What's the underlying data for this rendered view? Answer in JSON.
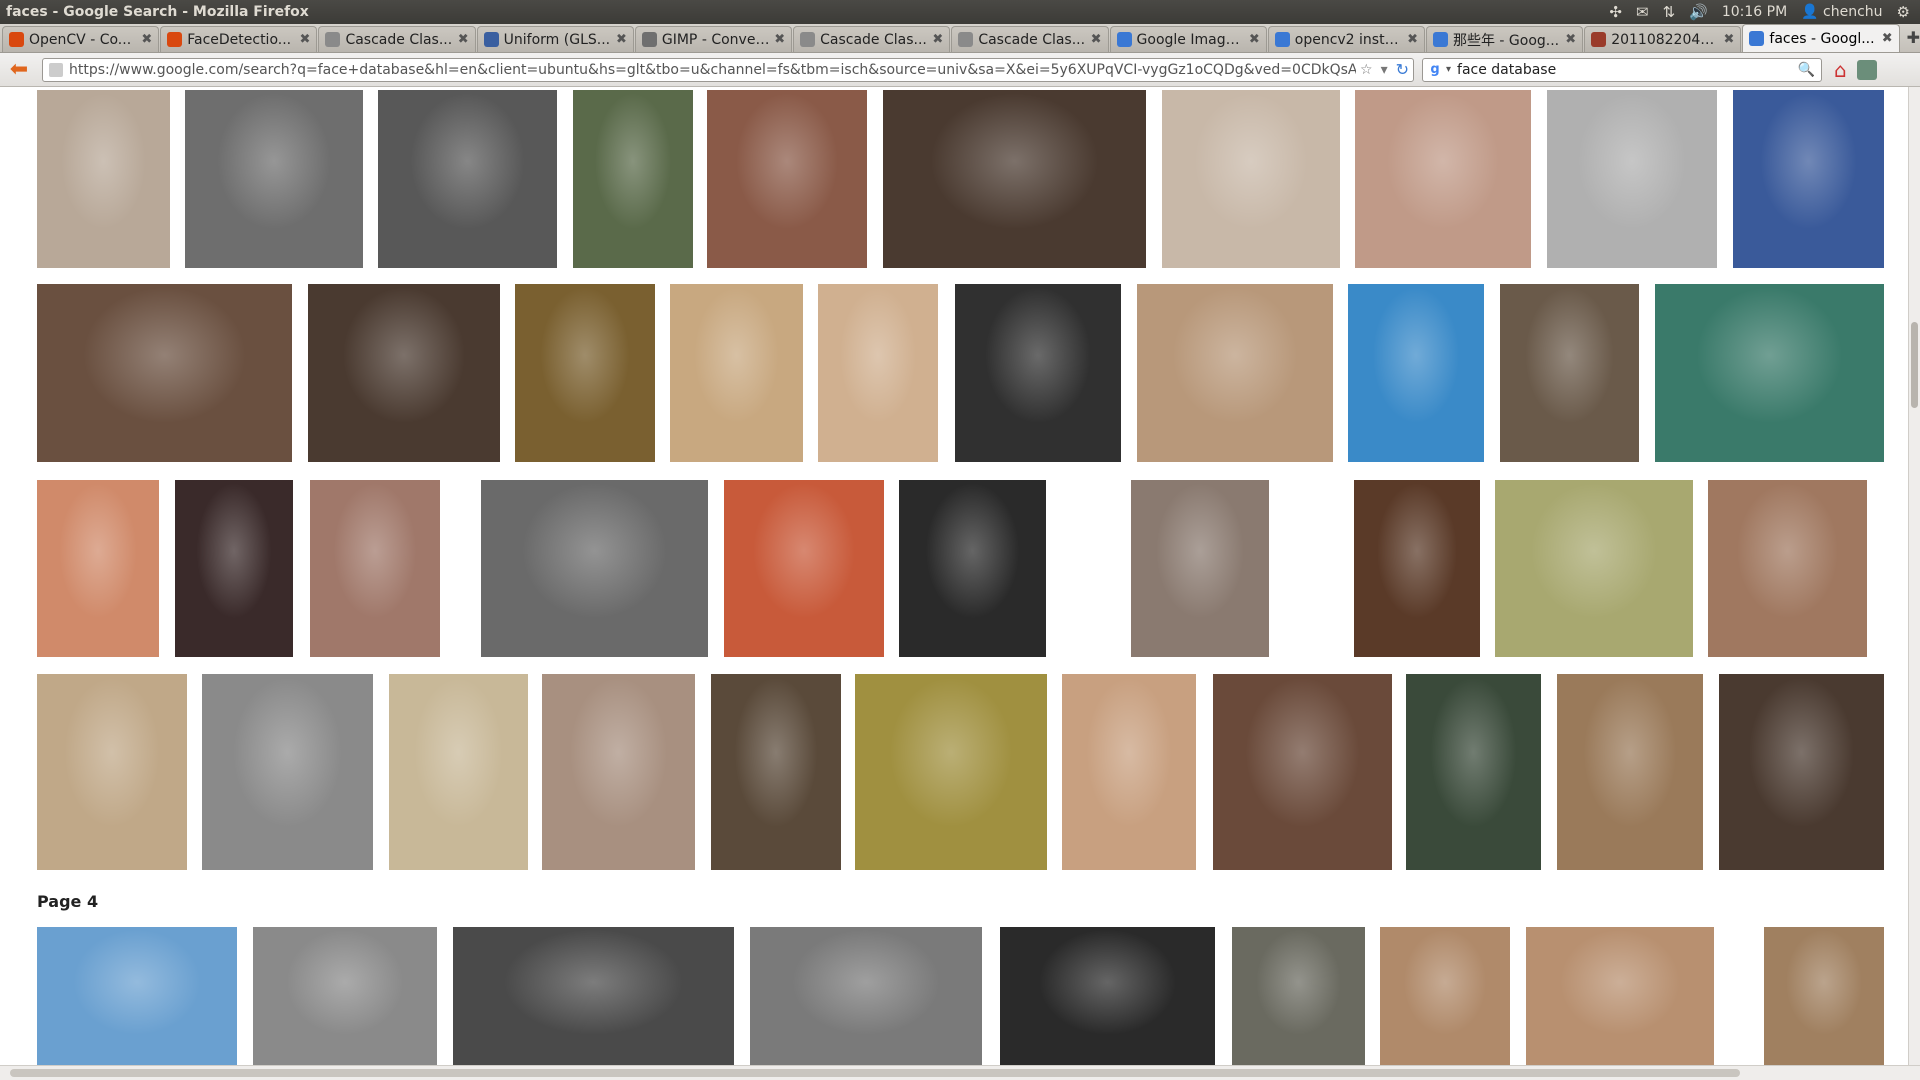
{
  "window": {
    "title": "faces - Google Search - Mozilla Firefox"
  },
  "tray": {
    "time": "10:16 PM",
    "user": "chenchu"
  },
  "tabs": [
    {
      "label": "OpenCV - Co...",
      "favicon_color": "#d9480f"
    },
    {
      "label": "FaceDetectio...",
      "favicon_color": "#d9480f"
    },
    {
      "label": "Cascade Clas...",
      "favicon_color": "#8a8a8a"
    },
    {
      "label": "Uniform (GLS...",
      "favicon_color": "#3a5fa0"
    },
    {
      "label": "GIMP - Conver...",
      "favicon_color": "#6f6f6f"
    },
    {
      "label": "Cascade Clas...",
      "favicon_color": "#8a8a8a"
    },
    {
      "label": "Cascade Clas...",
      "favicon_color": "#8a8a8a"
    },
    {
      "label": "Google Image...",
      "favicon_color": "#3a78d4"
    },
    {
      "label": "opencv2 insta...",
      "favicon_color": "#3a78d4"
    },
    {
      "label": "那些年 - Goog...",
      "favicon_color": "#3a78d4"
    },
    {
      "label": "20110822042...",
      "favicon_color": "#9a3b2a"
    },
    {
      "label": "faces - Googl...",
      "favicon_color": "#3a78d4",
      "active": true
    }
  ],
  "navbar": {
    "url": "https://www.google.com/search?q=face+database&hl=en&client=ubuntu&hs=glt&tbo=u&channel=fs&tbm=isch&source=univ&sa=X&ei=5y6XUPqVCI-vygGz1oCQDg&ved=0CDkQsAQ&biw=1472&bi",
    "search_query": "face database"
  },
  "results": {
    "page_label": "Page 4",
    "thumbnails": [
      {
        "color": "#b8a898"
      },
      {
        "color": "#6e6e6e"
      },
      {
        "color": "#585858"
      },
      {
        "color": "#5a6a4a"
      },
      {
        "color": "#8a5a48"
      },
      {
        "color": "#4a3a30"
      },
      {
        "color": "#c8b8a8"
      },
      {
        "color": "#c09a88"
      },
      {
        "color": "#b0b0b0"
      },
      {
        "color": "#3a5a9a"
      },
      {
        "color": "#6a5040"
      },
      {
        "color": "#4a3a30"
      },
      {
        "color": "#7a6030"
      },
      {
        "color": "#c8a880"
      },
      {
        "color": "#d0b090"
      },
      {
        "color": "#303030"
      },
      {
        "color": "#b8987a"
      },
      {
        "color": "#3a8ac8"
      },
      {
        "color": "#6a5a4a"
      },
      {
        "color": "#3a7a6a"
      },
      {
        "color": "#d08a6a"
      },
      {
        "color": "#3a2a2a"
      },
      {
        "color": "#a0786a"
      },
      {
        "color": "#6a6a6a"
      },
      {
        "color": "#c85a3a"
      },
      {
        "color": "#2a2a2a"
      },
      {
        "color": "#8a7a70"
      },
      {
        "color": "#5a3a28"
      },
      {
        "color": "#a8a870"
      },
      {
        "color": "#a07860"
      },
      {
        "color": "#c0a888"
      },
      {
        "color": "#8a8a8a"
      },
      {
        "color": "#c8b898"
      },
      {
        "color": "#a89080"
      },
      {
        "color": "#5a4a3a"
      },
      {
        "color": "#a09040"
      },
      {
        "color": "#c8a080"
      },
      {
        "color": "#6a4a3a"
      },
      {
        "color": "#3a4a3a"
      },
      {
        "color": "#9a7a5a"
      },
      {
        "color": "#4a3a30"
      },
      {
        "color": "#6aa0d0"
      },
      {
        "color": "#8a8a8a"
      },
      {
        "color": "#4a4a4a"
      },
      {
        "color": "#7a7a7a"
      },
      {
        "color": "#2a2a2a"
      },
      {
        "color": "#6a6a60"
      },
      {
        "color": "#b08a6a"
      },
      {
        "color": "#b89070"
      },
      {
        "color": "#a08060"
      }
    ]
  }
}
